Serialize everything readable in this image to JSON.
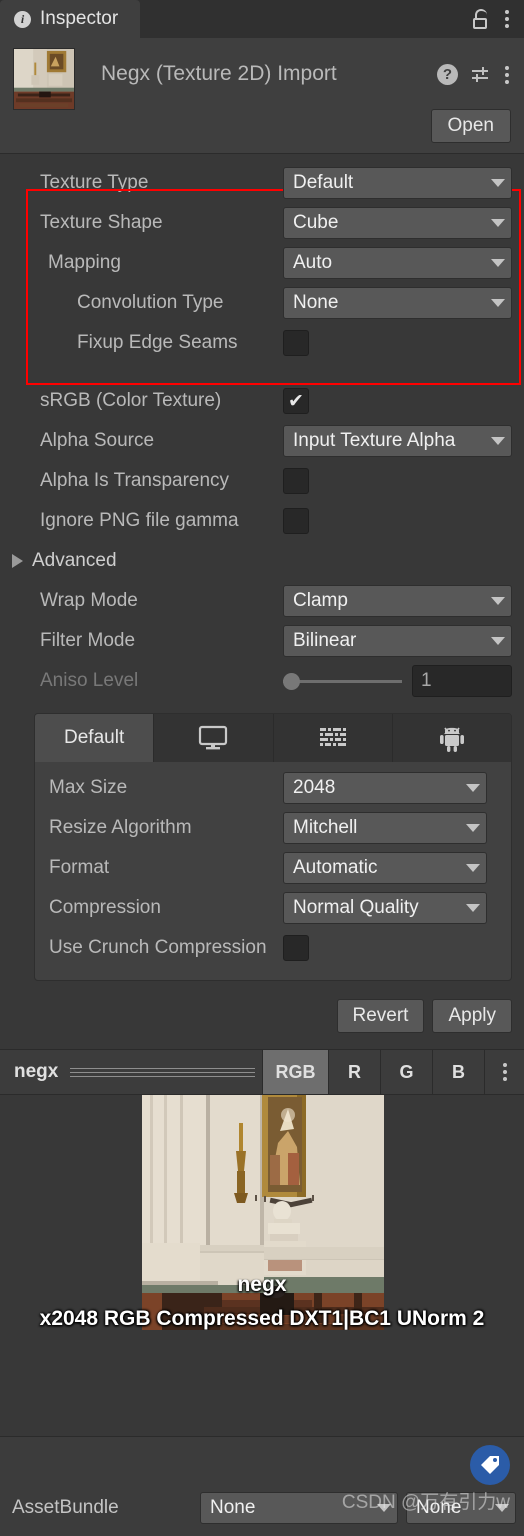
{
  "window": {
    "tab_label": "Inspector",
    "info_glyph": "i",
    "lock_icon": "unlock-icon",
    "menu_icon": "kebab-menu-icon"
  },
  "header": {
    "title": "Negx (Texture 2D) Import",
    "help_glyph": "?",
    "open_label": "Open"
  },
  "properties": {
    "texture_type": {
      "label": "Texture Type",
      "value": "Default"
    },
    "texture_shape": {
      "label": "Texture Shape",
      "value": "Cube"
    },
    "mapping": {
      "label": "Mapping",
      "value": "Auto"
    },
    "convolution_type": {
      "label": "Convolution Type",
      "value": "None"
    },
    "fixup_edge_seams": {
      "label": "Fixup Edge Seams",
      "checked": false
    },
    "srgb": {
      "label": "sRGB (Color Texture)",
      "checked": true
    },
    "alpha_source": {
      "label": "Alpha Source",
      "value": "Input Texture Alpha"
    },
    "alpha_is_transparency": {
      "label": "Alpha Is Transparency",
      "checked": false
    },
    "ignore_png_gamma": {
      "label": "Ignore PNG file gamma",
      "checked": false
    },
    "advanced": {
      "label": "Advanced",
      "expanded": false
    },
    "wrap_mode": {
      "label": "Wrap Mode",
      "value": "Clamp"
    },
    "filter_mode": {
      "label": "Filter Mode",
      "value": "Bilinear"
    },
    "aniso_level": {
      "label": "Aniso Level",
      "value": "1",
      "slider_percent": 0
    }
  },
  "platform": {
    "tabs": [
      {
        "label": "Default",
        "icon": "",
        "selected": true
      },
      {
        "label": "",
        "icon": "monitor-icon",
        "selected": false
      },
      {
        "label": "",
        "icon": "console-icon",
        "selected": false
      },
      {
        "label": "",
        "icon": "android-icon",
        "selected": false
      }
    ],
    "max_size": {
      "label": "Max Size",
      "value": "2048"
    },
    "resize_algorithm": {
      "label": "Resize Algorithm",
      "value": "Mitchell"
    },
    "format": {
      "label": "Format",
      "value": "Automatic"
    },
    "compression": {
      "label": "Compression",
      "value": "Normal Quality"
    },
    "use_crunch": {
      "label": "Use Crunch Compression",
      "checked": false
    }
  },
  "actions": {
    "revert_label": "Revert",
    "apply_label": "Apply"
  },
  "preview": {
    "name": "negx",
    "channels": [
      {
        "label": "RGB",
        "selected": true
      },
      {
        "label": "R",
        "selected": false
      },
      {
        "label": "G",
        "selected": false
      },
      {
        "label": "B",
        "selected": false
      }
    ],
    "menu_icon": "kebab-menu-icon",
    "caption": "negx",
    "status": "x2048  RGB Compressed DXT1|BC1 UNorm  2"
  },
  "footer": {
    "assetbundle_label": "AssetBundle",
    "assetbundle_value": "None",
    "variant_value": "None",
    "tag_icon": "tag-icon",
    "watermark": "CSDN @万有引力w"
  },
  "colors": {
    "background": "#383838",
    "panel": "#3f3f3f",
    "dropdown": "#585858",
    "highlight_box": "#ff0000",
    "text": "#b9b9b9",
    "badge_blue": "#2b5ca8"
  }
}
